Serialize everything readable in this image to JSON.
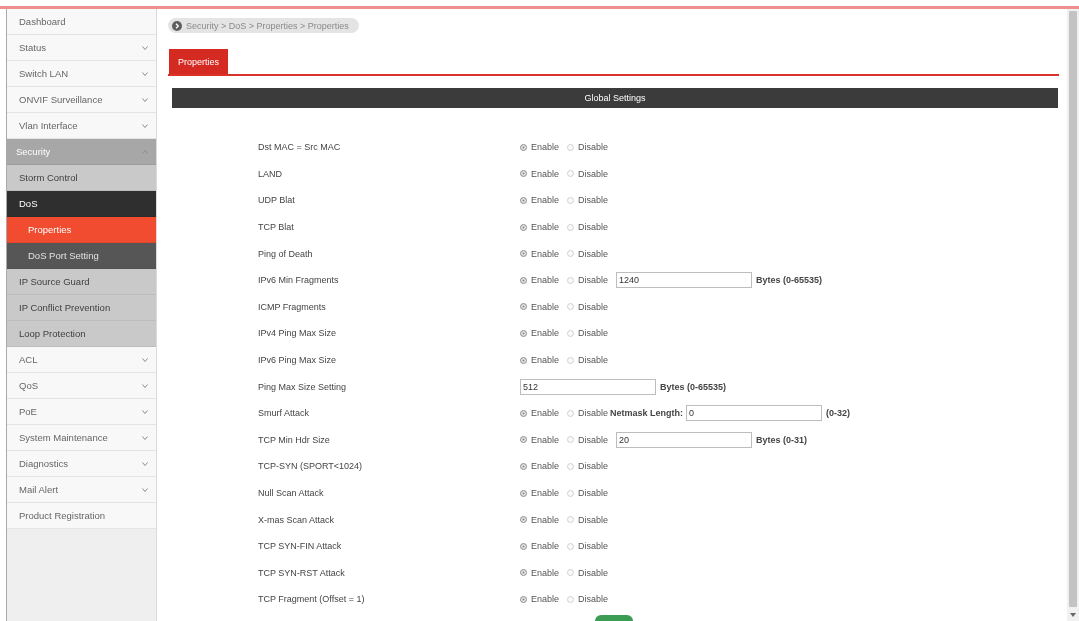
{
  "sidebar": {
    "items": [
      {
        "label": "Dashboard",
        "expandable": false,
        "expanded": false
      },
      {
        "label": "Status",
        "expandable": true,
        "expanded": false
      },
      {
        "label": "Switch LAN",
        "expandable": true,
        "expanded": false
      },
      {
        "label": "ONVIF Surveillance",
        "expandable": true,
        "expanded": false
      },
      {
        "label": "Vlan Interface",
        "expandable": true,
        "expanded": false
      },
      {
        "label": "Security",
        "expandable": true,
        "expanded": true,
        "children": [
          {
            "label": "Storm Control",
            "expanded": false
          },
          {
            "label": "DoS",
            "expanded": true,
            "children": [
              {
                "label": "Properties",
                "selected": true
              },
              {
                "label": "DoS Port Setting",
                "selected": false
              }
            ]
          },
          {
            "label": "IP Source Guard",
            "expanded": false
          },
          {
            "label": "IP Conflict Prevention",
            "expanded": false
          },
          {
            "label": "Loop Protection",
            "expanded": false
          }
        ]
      },
      {
        "label": "ACL",
        "expandable": true,
        "expanded": false
      },
      {
        "label": "QoS",
        "expandable": true,
        "expanded": false
      },
      {
        "label": "PoE",
        "expandable": true,
        "expanded": false
      },
      {
        "label": "System Maintenance",
        "expandable": true,
        "expanded": false
      },
      {
        "label": "Diagnostics",
        "expandable": true,
        "expanded": false
      },
      {
        "label": "Mail Alert",
        "expandable": true,
        "expanded": false
      },
      {
        "label": "Product Registration",
        "expandable": false,
        "expanded": false
      }
    ]
  },
  "breadcrumb": {
    "path": "Security > DoS > Properties > Properties"
  },
  "tabs": [
    {
      "label": "Properties",
      "selected": true
    }
  ],
  "section": {
    "title": "Global Settings",
    "rows": [
      {
        "label": "Dst MAC = Src MAC",
        "kind": "toggle",
        "options": [
          {
            "label": "Enable",
            "selected": true
          },
          {
            "label": "Disable",
            "selected": false
          }
        ]
      },
      {
        "label": "LAND",
        "kind": "toggle",
        "options": [
          {
            "label": "Enable",
            "selected": true
          },
          {
            "label": "Disable",
            "selected": false
          }
        ]
      },
      {
        "label": "UDP Blat",
        "kind": "toggle",
        "options": [
          {
            "label": "Enable",
            "selected": true
          },
          {
            "label": "Disable",
            "selected": false
          }
        ]
      },
      {
        "label": "TCP Blat",
        "kind": "toggle",
        "options": [
          {
            "label": "Enable",
            "selected": true
          },
          {
            "label": "Disable",
            "selected": false
          }
        ]
      },
      {
        "label": "Ping of Death",
        "kind": "toggle",
        "options": [
          {
            "label": "Enable",
            "selected": true
          },
          {
            "label": "Disable",
            "selected": false
          }
        ]
      },
      {
        "label": "IPv6 Min Fragments",
        "kind": "toggle_field",
        "options": [
          {
            "label": "Enable",
            "selected": true
          },
          {
            "label": "Disable",
            "selected": false
          }
        ],
        "field": {
          "value": "1240"
        },
        "unit": "Bytes (0-65535)"
      },
      {
        "label": "ICMP Fragments",
        "kind": "toggle",
        "options": [
          {
            "label": "Enable",
            "selected": true
          },
          {
            "label": "Disable",
            "selected": false
          }
        ]
      },
      {
        "label": "IPv4 Ping Max Size",
        "kind": "toggle",
        "options": [
          {
            "label": "Enable",
            "selected": true
          },
          {
            "label": "Disable",
            "selected": false
          }
        ]
      },
      {
        "label": "IPv6 Ping Max Size",
        "kind": "toggle",
        "options": [
          {
            "label": "Enable",
            "selected": true
          },
          {
            "label": "Disable",
            "selected": false
          }
        ]
      },
      {
        "label": "Ping Max Size Setting",
        "kind": "field",
        "field": {
          "value": "512"
        },
        "unit": "Bytes (0-65535)"
      },
      {
        "label": "Smurf Attack",
        "kind": "toggle_field",
        "options": [
          {
            "label": "Enable",
            "selected": true
          },
          {
            "label": "Disable",
            "selected": false
          }
        ],
        "field_label": "Netmask Length:",
        "field": {
          "value": "0"
        },
        "unit": "(0-32)"
      },
      {
        "label": "TCP Min Hdr Size",
        "kind": "toggle_field",
        "options": [
          {
            "label": "Enable",
            "selected": true
          },
          {
            "label": "Disable",
            "selected": false
          }
        ],
        "field": {
          "value": "20"
        },
        "unit": "Bytes (0-31)"
      },
      {
        "label": "TCP-SYN (SPORT<1024)",
        "kind": "toggle",
        "options": [
          {
            "label": "Enable",
            "selected": true
          },
          {
            "label": "Disable",
            "selected": false
          }
        ]
      },
      {
        "label": "Null Scan Attack",
        "kind": "toggle",
        "options": [
          {
            "label": "Enable",
            "selected": true
          },
          {
            "label": "Disable",
            "selected": false
          }
        ]
      },
      {
        "label": "X-mas Scan Attack",
        "kind": "toggle",
        "options": [
          {
            "label": "Enable",
            "selected": true
          },
          {
            "label": "Disable",
            "selected": false
          }
        ]
      },
      {
        "label": "TCP SYN-FIN Attack",
        "kind": "toggle",
        "options": [
          {
            "label": "Enable",
            "selected": true
          },
          {
            "label": "Disable",
            "selected": false
          }
        ]
      },
      {
        "label": "TCP SYN-RST Attack",
        "kind": "toggle",
        "options": [
          {
            "label": "Enable",
            "selected": true
          },
          {
            "label": "Disable",
            "selected": false
          }
        ]
      },
      {
        "label": "TCP Fragment (Offset = 1)",
        "kind": "toggle",
        "options": [
          {
            "label": "Enable",
            "selected": true
          },
          {
            "label": "Disable",
            "selected": false
          }
        ]
      }
    ]
  }
}
